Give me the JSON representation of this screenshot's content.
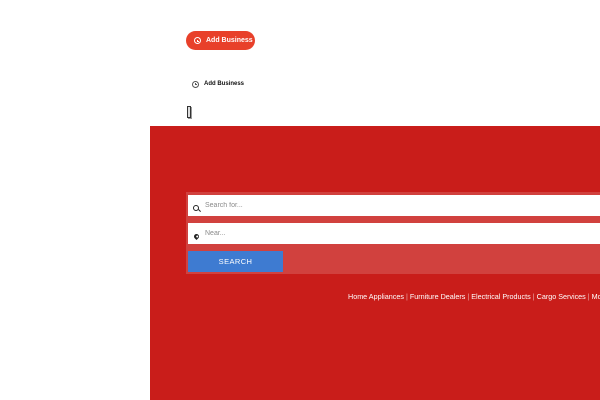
{
  "header": {
    "add_business_button": "Add Business",
    "add_business_link": "Add Business"
  },
  "search": {
    "what_placeholder": "Search for...",
    "where_placeholder": "Near...",
    "search_button": "SEARCH"
  },
  "categories": [
    "Home Appliances",
    "Furniture Dealers",
    "Electrical Products",
    "Cargo Services",
    "More"
  ],
  "colors": {
    "hero_red": "#c91d1a",
    "pill_red": "#e8402a",
    "search_blue": "#3e7bd1"
  },
  "icons": [
    "plus-circle-icon",
    "search-icon",
    "map-pin-icon"
  ]
}
